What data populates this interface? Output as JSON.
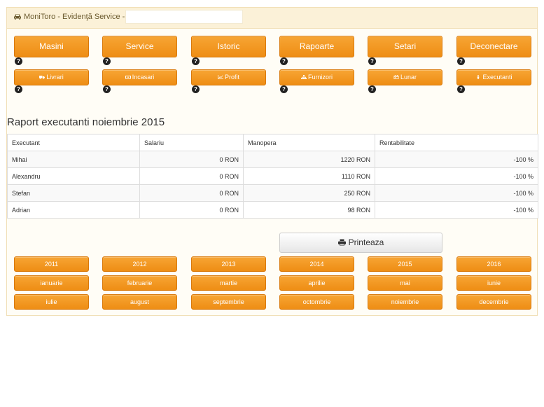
{
  "header": {
    "app_title": "MoniToro - Evidenţă Service -",
    "title_field_value": ""
  },
  "main_nav": [
    {
      "label": "Masini",
      "icon": ""
    },
    {
      "label": "Service",
      "icon": ""
    },
    {
      "label": "Istoric",
      "icon": ""
    },
    {
      "label": "Rapoarte",
      "icon": ""
    },
    {
      "label": "Setari",
      "icon": ""
    },
    {
      "label": "Deconectare",
      "icon": ""
    }
  ],
  "report_nav": [
    {
      "label": "Livrari",
      "icon": "truck-icon"
    },
    {
      "label": "Incasari",
      "icon": "money-icon"
    },
    {
      "label": "Profit",
      "icon": "chart-line-icon"
    },
    {
      "label": "Furnizori",
      "icon": "sitemap-icon"
    },
    {
      "label": "Lunar",
      "icon": "calendar-icon"
    },
    {
      "label": "Executanti",
      "icon": "person-icon"
    }
  ],
  "help_glyph": "?",
  "report": {
    "title": "Raport executanti noiembrie 2015",
    "columns": [
      "Executant",
      "Salariu",
      "Manopera",
      "Rentabilitate"
    ],
    "rows": [
      {
        "executant": "Mihai",
        "salariu": "0 RON",
        "manopera": "1220 RON",
        "rentabilitate": "-100  %"
      },
      {
        "executant": "Alexandru",
        "salariu": "0 RON",
        "manopera": "1110 RON",
        "rentabilitate": "-100  %"
      },
      {
        "executant": "Stefan",
        "salariu": "0 RON",
        "manopera": "250 RON",
        "rentabilitate": "-100  %"
      },
      {
        "executant": "Adrian",
        "salariu": "0 RON",
        "manopera": "98 RON",
        "rentabilitate": "-100  %"
      }
    ]
  },
  "print_button": {
    "label": "Printeaza",
    "icon": "print-icon"
  },
  "years": [
    "2011",
    "2012",
    "2013",
    "2014",
    "2015",
    "2016"
  ],
  "months_row1": [
    "ianuarie",
    "februarie",
    "martie",
    "aprilie",
    "mai",
    "iunie"
  ],
  "months_row2": [
    "iulie",
    "august",
    "septembrie",
    "octombrie",
    "noiembrie",
    "decembrie"
  ],
  "colors": {
    "accent": "#f39a22",
    "panel_bg": "#fffdf6",
    "heading_bg": "#fbf1d8"
  }
}
